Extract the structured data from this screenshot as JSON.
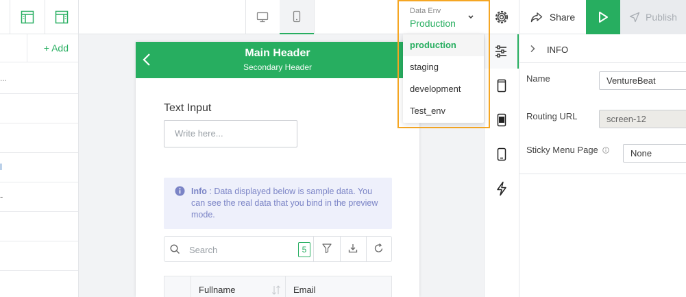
{
  "toolbar": {
    "env_caption": "Data Env",
    "env_value": "Production",
    "share_label": "Share",
    "publish_label": "Publish"
  },
  "left_panel": {
    "add_label": "+ Add",
    "rows": [
      "...",
      "",
      "",
      "l",
      "-",
      "",
      ""
    ]
  },
  "phone": {
    "header_title": "Main Header",
    "header_subtitle": "Secondary Header",
    "text_input_label": "Text Input",
    "text_input_placeholder": "Write here...",
    "info_title": "Info",
    "info_text": " : Data displayed below is sample data. You can see the real data that you bind in the preview mode.",
    "search_placeholder": "Search",
    "result_count": "5",
    "columns": [
      "Fullname",
      "Email"
    ]
  },
  "env_dropdown": {
    "options": [
      "production",
      "staging",
      "development",
      "Test_env"
    ],
    "selected": "production"
  },
  "props": {
    "section_title": "INFO",
    "name_label": "Name",
    "name_value": "VentureBeat",
    "routing_label": "Routing URL",
    "routing_value": "screen-12",
    "sticky_label": "Sticky Menu Page",
    "sticky_value": "None"
  },
  "colors": {
    "accent": "#27ae60",
    "highlight_outline": "#f5a623",
    "info_text": "#7b84c6"
  }
}
